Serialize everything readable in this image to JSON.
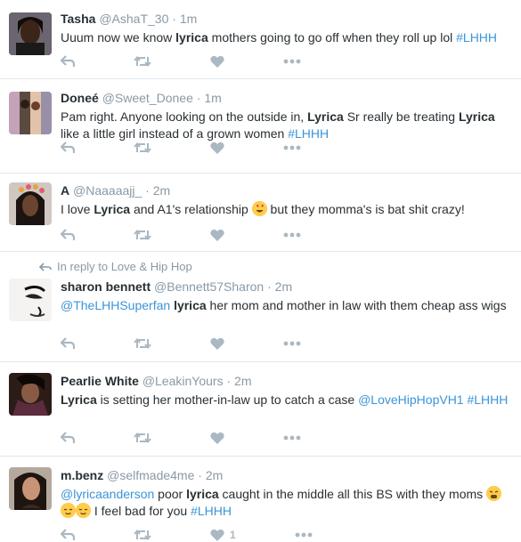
{
  "tweets": [
    {
      "name": "Tasha",
      "handle": "@AshaT_30",
      "time": "1m",
      "text": [
        [
          "t",
          "Uuum now we know "
        ],
        [
          "b",
          "lyrica"
        ],
        [
          "t",
          " mothers going to go off when they roll up lol "
        ],
        [
          "l",
          "#LHHH"
        ]
      ]
    },
    {
      "name": "Doneé",
      "handle": "@Sweet_Donee",
      "time": "1m",
      "text": [
        [
          "t",
          "Pam right. Anyone looking on the outside in, "
        ],
        [
          "b",
          "Lyrica"
        ],
        [
          "t",
          " Sr really be treating "
        ],
        [
          "b",
          "Lyrica"
        ],
        [
          "t",
          " like a little girl instead of a grown women "
        ],
        [
          "l",
          "#LHHH"
        ]
      ]
    },
    {
      "name": "A",
      "handle": "@Naaaaajj_",
      "time": "2m",
      "text": [
        [
          "t",
          "I love "
        ],
        [
          "b",
          "Lyrica"
        ],
        [
          "t",
          " and A1's relationship "
        ],
        [
          "e",
          "heart-eyes"
        ],
        [
          "t",
          " but they momma's is bat shit crazy!"
        ]
      ]
    },
    {
      "reply_context": "In reply to Love & Hip Hop",
      "name": "sharon bennett",
      "handle": "@Bennett57Sharon",
      "time": "2m",
      "text": [
        [
          "l",
          "@TheLHHSuperfan"
        ],
        [
          "t",
          " "
        ],
        [
          "b",
          "lyrica"
        ],
        [
          "t",
          " her mom and mother in law with them cheap ass wigs"
        ]
      ]
    },
    {
      "name": "Pearlie White",
      "handle": "@LeakinYours",
      "time": "2m",
      "text": [
        [
          "b",
          "Lyrica"
        ],
        [
          "t",
          " is setting her mother-in-law up to catch a case "
        ],
        [
          "l",
          "@LoveHipHopVH1"
        ],
        [
          "t",
          " "
        ],
        [
          "l",
          "#LHHH"
        ]
      ]
    },
    {
      "name": "m.benz",
      "handle": "@selfmade4me",
      "time": "2m",
      "text": [
        [
          "l",
          "@lyricaanderson"
        ],
        [
          "t",
          " poor "
        ],
        [
          "b",
          "lyrica"
        ],
        [
          "t",
          " caught in the middle all this BS with they moms "
        ],
        [
          "e",
          "weary"
        ],
        [
          "t",
          " "
        ],
        [
          "e",
          "relieved"
        ],
        [
          "e",
          "relieved"
        ],
        [
          "t",
          " I feel bad for you "
        ],
        [
          "l",
          "#LHHH"
        ]
      ]
    }
  ],
  "last_tweet_like_count": "1",
  "dot_separator": "·",
  "icons": [
    "reply-icon",
    "retweet-icon",
    "like-icon",
    "more-icon",
    "reply-arrow-icon"
  ],
  "colors": {
    "link": "#3b94d9",
    "muted": "#8899a6",
    "text": "#292f33",
    "border": "#e1e8ed"
  }
}
